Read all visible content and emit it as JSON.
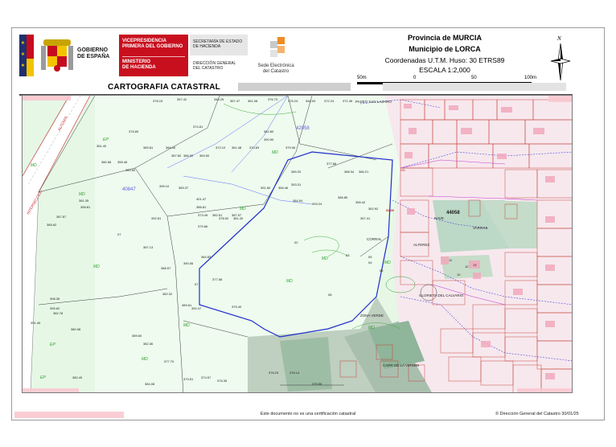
{
  "header": {
    "gov_line1": "GOBIERNO",
    "gov_line2": "DE ESPAÑA",
    "vice_line1": "VICEPRESIDENCIA",
    "vice_line2": "PRIMERA DEL GOBIERNO",
    "min_line1": "MINISTERIO",
    "min_line2": "DE HACIENDA",
    "sec_line1": "SECRETARÍA DE ESTADO",
    "sec_line2": "DE HACIENDA",
    "dir_line1": "DIRECCIÓN GENERAL",
    "dir_line2": "DEL CATASTRO",
    "sede_line1": "Sede Electrónica",
    "sede_line2": "del Catastro",
    "province": "Provincia de MURCIA",
    "municipality": "Municipio de LORCA",
    "coords": "Coordenadas U.T.M. Huso: 30 ETRS89",
    "scale": "ESCALA 1:2,000",
    "north": "N",
    "title": "CARTOGRAFIA CATASTRAL"
  },
  "scalebar": {
    "labels": [
      "50m",
      "0",
      "50",
      "100m"
    ]
  },
  "map": {
    "polygons": [
      "40847",
      "42058",
      "44058"
    ],
    "zones": [
      "EP",
      "MD",
      "MD",
      "MD",
      "MD",
      "MD",
      "MD",
      "MD",
      "MD",
      "MD",
      "EP",
      "EP",
      "MD",
      "MD"
    ],
    "streets": [
      "AUTOVIA",
      "INTERSECCION",
      "PASEO SAN LAZARO",
      "ALFEREZ",
      "NAVE",
      "VARGAS",
      "GLORIETA DEL CALVARIO",
      "ZONA VERDE",
      "CARR DE LA VIRGEN",
      "CORRAL"
    ],
    "elevations": [
      "378.15",
      "357.42",
      "349.25",
      "367.47",
      "361.08",
      "376.73",
      "375.24",
      "348.03",
      "372.24",
      "371.46",
      "374.81",
      "372.10",
      "361.48",
      "370.83",
      "362.80",
      "390.50",
      "379.06",
      "377.86",
      "388.34",
      "386.21",
      "389.81",
      "384.40",
      "387.60",
      "386.50",
      "369.50",
      "375.80",
      "381.40",
      "380.58",
      "355.48",
      "360.50",
      "351.60",
      "356.46",
      "353.31",
      "389.20",
      "384.54",
      "393.24",
      "386.85",
      "356.42",
      "357.41",
      "362.92",
      "395.10",
      "389.37",
      "401.47",
      "388.81",
      "382.51",
      "381.35",
      "358.81",
      "387.87",
      "385.62",
      "392.81",
      "373.45",
      "378.52",
      "381.40",
      "387.57",
      "387.13",
      "388.57",
      "379.66",
      "390.06",
      "384.83",
      "377.58",
      "375.40",
      "382.32",
      "389.81",
      "392.47",
      "389.60",
      "382.36",
      "377.70",
      "373.51",
      "374.57",
      "376.35",
      "398.35",
      "395.62",
      "382.78",
      "380.98",
      "378.23",
      "376.14",
      "379.55",
      "384.08",
      "382.40",
      "391.40"
    ],
    "labels_c": [
      "02",
      "03",
      "04",
      "05",
      "06",
      "07",
      "08",
      "10",
      "11",
      "12",
      "13"
    ],
    "cadastral_ids": [
      "SA50",
      "HD"
    ]
  },
  "footer": {
    "note": "Este documento no es una certificación catastral",
    "copyright": "© Dirección General del Catastro 30/01/25"
  }
}
